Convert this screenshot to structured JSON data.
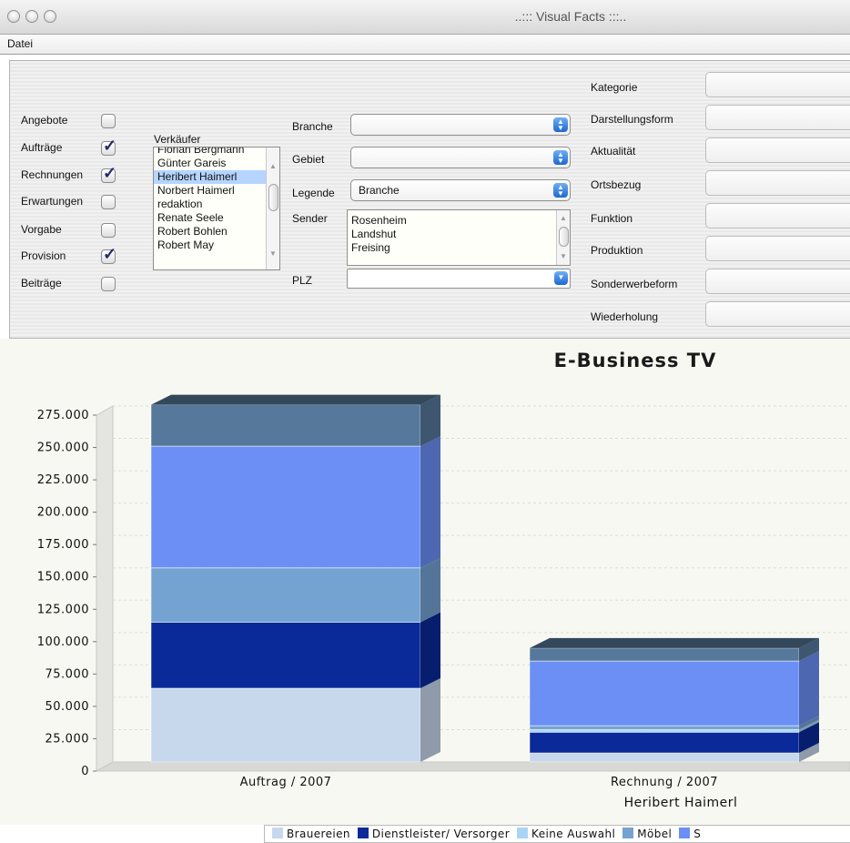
{
  "window": {
    "title": "..::: Visual Facts :::.."
  },
  "menu": {
    "datei": "Datei"
  },
  "checkboxes": [
    {
      "label": "Angebote",
      "checked": false
    },
    {
      "label": "Aufträge",
      "checked": true
    },
    {
      "label": "Rechnungen",
      "checked": true
    },
    {
      "label": "Erwartungen",
      "checked": false
    },
    {
      "label": "Vorgabe",
      "checked": false
    },
    {
      "label": "Provision",
      "checked": true
    },
    {
      "label": "Beiträge",
      "checked": false
    }
  ],
  "verkaeufer": {
    "label": "Verkäufer",
    "items": [
      "Florian Bergmann",
      "Günter Gareis",
      "Heribert Haimerl",
      "Norbert Haimerl",
      "redaktion",
      "Renate Seele",
      "Robert Bohlen",
      "Robert May"
    ],
    "selected": "Heribert Haimerl"
  },
  "filters": {
    "branche": {
      "label": "Branche",
      "value": ""
    },
    "gebiet": {
      "label": "Gebiet",
      "value": ""
    },
    "legende": {
      "label": "Legende",
      "value": "Branche"
    },
    "sender": {
      "label": "Sender",
      "items": [
        "Rosenheim",
        "Landshut",
        "Freising"
      ]
    },
    "plz": {
      "label": "PLZ",
      "value": ""
    }
  },
  "right_fields": [
    {
      "label": "Kategorie"
    },
    {
      "label": "Darstellungsform"
    },
    {
      "label": "Aktualität"
    },
    {
      "label": "Ortsbezug"
    },
    {
      "label": "Funktion"
    },
    {
      "label": "Produktion"
    },
    {
      "label": "Sonderwerbeform"
    },
    {
      "label": "Wiederholung"
    }
  ],
  "chart_data": {
    "type": "bar",
    "stacked": true,
    "title": "E-Business TV",
    "xlabel": "Heribert Haimerl",
    "ylabel": "",
    "ylim": [
      0,
      275000
    ],
    "yticks": [
      "0",
      "25.000",
      "50.000",
      "75.000",
      "100.000",
      "125.000",
      "150.000",
      "175.000",
      "200.000",
      "225.000",
      "250.000",
      "275.000"
    ],
    "categories": [
      "Auftrag /  2007",
      "Rechnung /  2007"
    ],
    "series": [
      {
        "name": "Brauereien",
        "color": "#c7d7ec",
        "values": [
          57000,
          7000
        ]
      },
      {
        "name": "Dienstleister/ Versorger",
        "color": "#0a2a99",
        "values": [
          51000,
          16000
        ]
      },
      {
        "name": "Keine Auswahl",
        "color": "#a9d4f5",
        "values": [
          0,
          2000
        ]
      },
      {
        "name": "Möbel",
        "color": "#74a3d2",
        "values": [
          42000,
          3000
        ]
      },
      {
        "name": "S",
        "color": "#6b8ff5",
        "values": [
          94000,
          50000
        ]
      },
      {
        "name": "",
        "color": "#56789a",
        "values": [
          32000,
          10000
        ]
      }
    ],
    "grid": true,
    "legend_position": "bottom"
  }
}
